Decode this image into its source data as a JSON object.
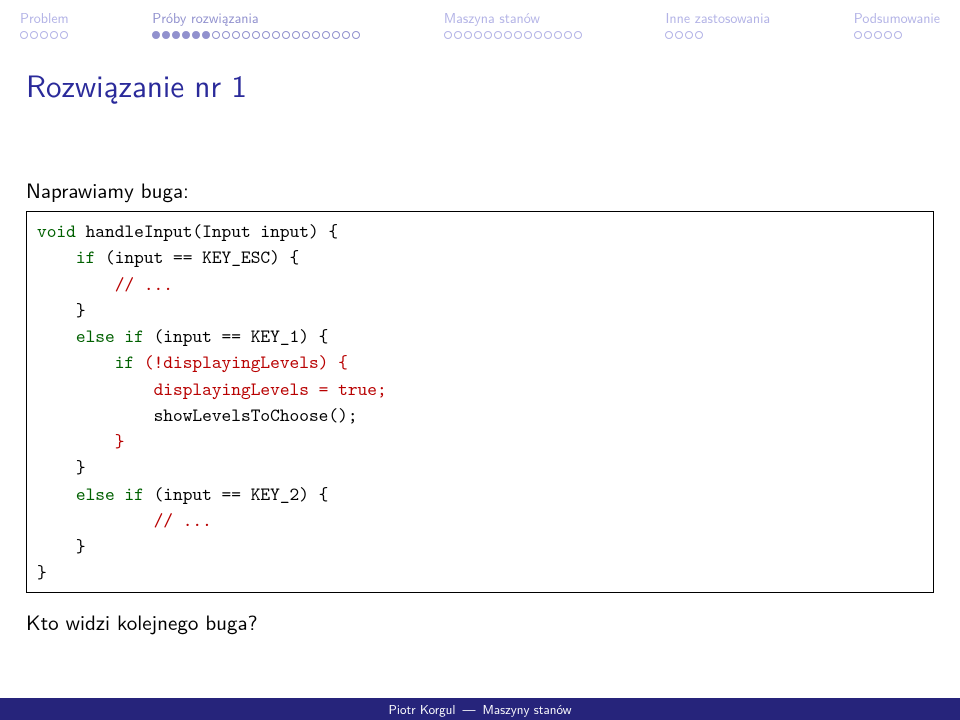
{
  "nav": [
    {
      "label": "Problem",
      "total": 5,
      "filled": 0,
      "current": false
    },
    {
      "label": "Próby rozwiązania",
      "total": 21,
      "filled": 6,
      "current": true
    },
    {
      "label": "Maszyna stanów",
      "total": 14,
      "filled": 0,
      "current": false
    },
    {
      "label": "Inne zastosowania",
      "total": 4,
      "filled": 0,
      "current": false
    },
    {
      "label": "Podsumowanie",
      "total": 5,
      "filled": 0,
      "current": false
    }
  ],
  "title": "Rozwiązanie nr 1",
  "lead_text": "Naprawiamy buga:",
  "code": {
    "l1_kw1": "void",
    "l1_rest": " handleInput(Input input) {",
    "l2_kw1": "if",
    "l2_rest": " (input == KEY_ESC) {",
    "l3_hl": "// ...",
    "l4": "}",
    "l5_kw1": "else if",
    "l5_rest": " (input == KEY_1) {",
    "l6_kw1": "if",
    "l6_hl": " (!displayingLevels) {",
    "l7_hl": "displayingLevels = true;",
    "l8": "showLevelsToChoose();",
    "l9_hl": "}",
    "l10": "}",
    "l11_kw1": "else if",
    "l11_rest": " (input == KEY_2) {",
    "l12_hl": "// ...",
    "l13": "}",
    "l14": "}"
  },
  "closing_text": "Kto widzi kolejnego buga?",
  "footer": {
    "author": "Piotr Korgul",
    "title": "Maszyny stanów",
    "sep": "—"
  }
}
